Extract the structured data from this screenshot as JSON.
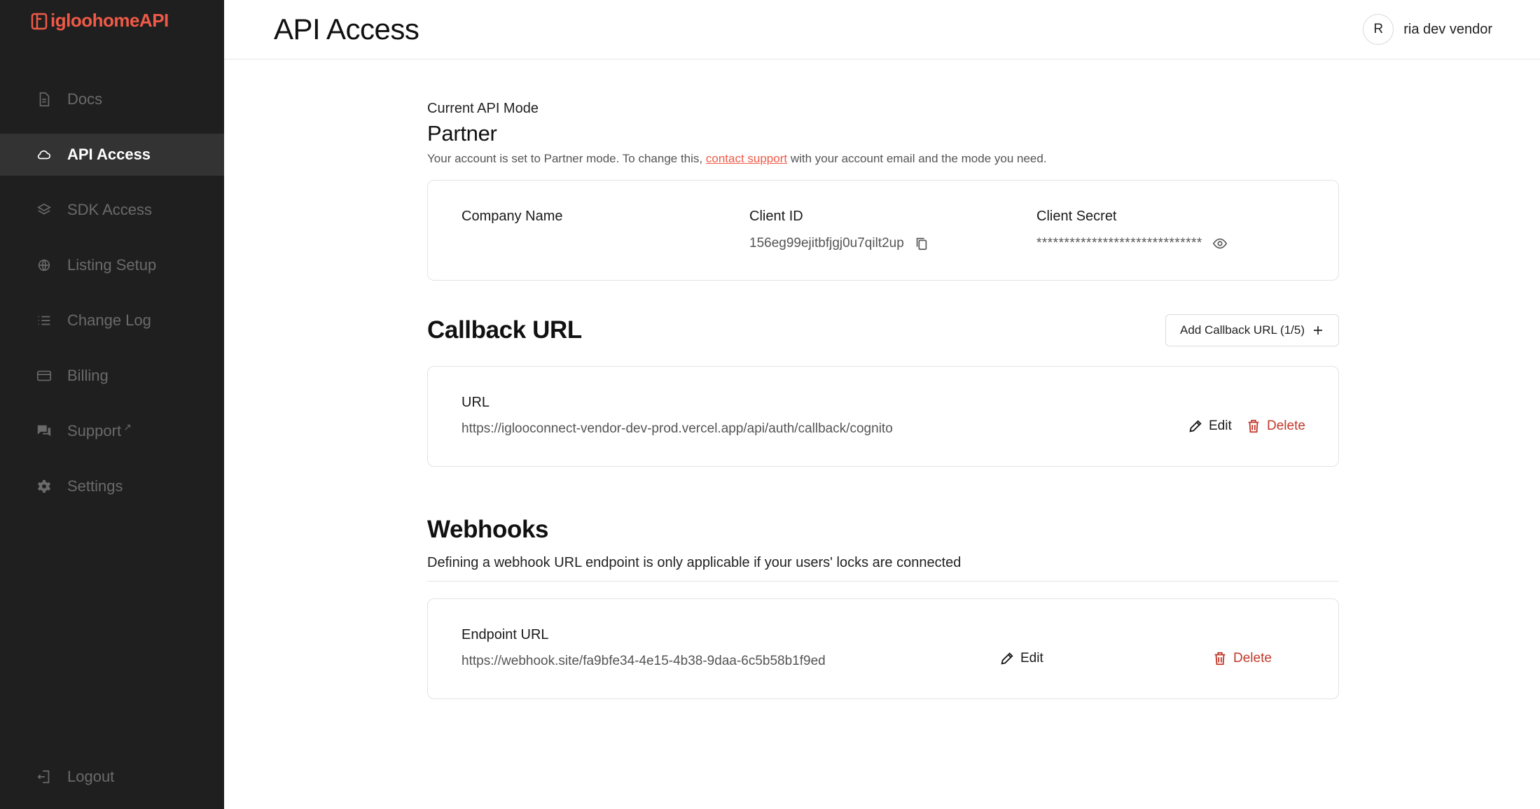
{
  "brand": {
    "name": "igloohomeAPI",
    "accent": "#ef5a48"
  },
  "sidebar": {
    "items": [
      {
        "label": "Docs",
        "icon": "document-icon",
        "active": false
      },
      {
        "label": "API Access",
        "icon": "cloud-icon",
        "active": true
      },
      {
        "label": "SDK Access",
        "icon": "layers-icon",
        "active": false
      },
      {
        "label": "Listing Setup",
        "icon": "globe-icon",
        "active": false
      },
      {
        "label": "Change Log",
        "icon": "list-icon",
        "active": false
      },
      {
        "label": "Billing",
        "icon": "credit-card-icon",
        "active": false
      },
      {
        "label": "Support",
        "icon": "chat-icon",
        "active": false,
        "external": "↗"
      },
      {
        "label": "Settings",
        "icon": "gear-icon",
        "active": false
      }
    ],
    "logout": "Logout"
  },
  "header": {
    "title": "API Access",
    "user": {
      "initial": "R",
      "name": "ria dev vendor"
    }
  },
  "api_mode": {
    "label": "Current API Mode",
    "value": "Partner",
    "desc_before": "Your account is set to Partner mode. To change this, ",
    "link": "contact support",
    "desc_after": " with your account email and the mode you need."
  },
  "credentials": {
    "company_label": "Company Name",
    "company_value": "",
    "client_id_label": "Client ID",
    "client_id_value": "156eg99ejitbfjgj0u7qilt2up",
    "client_secret_label": "Client Secret",
    "client_secret_value": "******************************"
  },
  "callback": {
    "title": "Callback URL",
    "add_button": "Add Callback URL (1/5)",
    "url_label": "URL",
    "url_value": "https://iglooconnect-vendor-dev-prod.vercel.app/api/auth/callback/cognito",
    "edit": "Edit",
    "delete": "Delete"
  },
  "webhooks": {
    "title": "Webhooks",
    "desc": "Defining a webhook URL endpoint is only applicable if your users' locks are connected",
    "endpoint_label": "Endpoint URL",
    "endpoint_value": "https://webhook.site/fa9bfe34-4e15-4b38-9daa-6c5b58b1f9ed",
    "edit": "Edit",
    "delete": "Delete"
  }
}
